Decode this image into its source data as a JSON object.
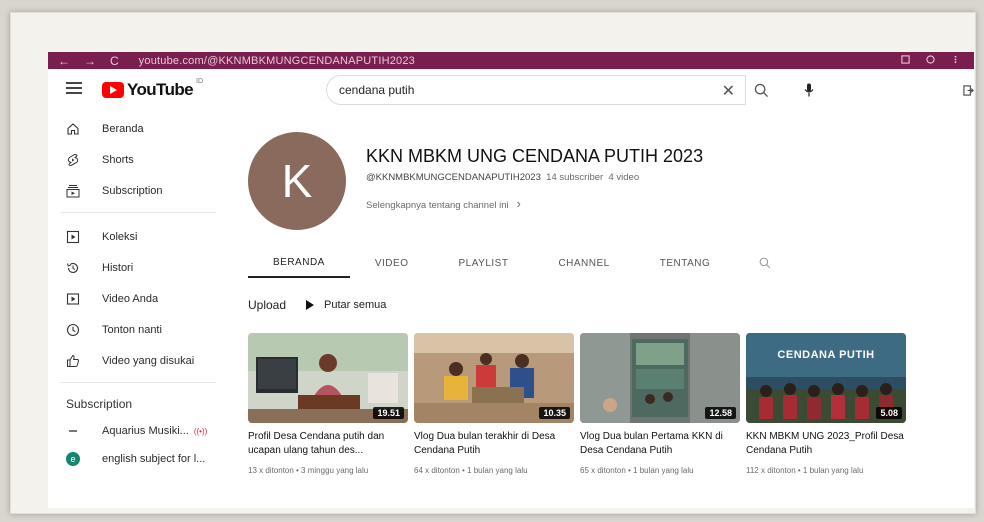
{
  "browser": {
    "back_glyph": "←",
    "forward_glyph": "→",
    "reload_glyph": "C",
    "url": "youtube.com/@KKNMBKMUNGCENDANAPUTIH2023"
  },
  "header": {
    "logo_text": "YouTube",
    "logo_region": "ID",
    "search_value": "cendana putih",
    "clear_glyph": "✕"
  },
  "sidebar": {
    "primary": [
      {
        "label": "Beranda",
        "icon": "home-icon"
      },
      {
        "label": "Shorts",
        "icon": "shorts-icon"
      },
      {
        "label": "Subscription",
        "icon": "subscriptions-icon"
      }
    ],
    "library": [
      {
        "label": "Koleksi",
        "icon": "library-icon"
      },
      {
        "label": "Histori",
        "icon": "history-icon"
      },
      {
        "label": "Video Anda",
        "icon": "your-videos-icon"
      },
      {
        "label": "Tonton nanti",
        "icon": "watch-later-icon"
      },
      {
        "label": "Video yang disukai",
        "icon": "liked-videos-icon"
      }
    ],
    "subscriptions_heading": "Subscription",
    "subscriptions": [
      {
        "label": "Aquarius Musiki...",
        "live": "((•))",
        "color": "#7a7a7a"
      },
      {
        "label": "english subject for l...",
        "avatar_letter": "e",
        "color": "#14866e"
      }
    ]
  },
  "channel": {
    "avatar_letter": "K",
    "avatar_color": "#8a6a5c",
    "name": "KKN MBKM UNG CENDANA PUTIH 2023",
    "handle": "@KKNMBKMUNGCENDANAPUTIH2023",
    "subscribers": "14 subscriber",
    "video_count": "4 video",
    "more_link": "Selengkapnya tentang channel ini",
    "more_chevron": "›"
  },
  "tabs": [
    {
      "label": "BERANDA",
      "active": true
    },
    {
      "label": "VIDEO",
      "active": false
    },
    {
      "label": "PLAYLIST",
      "active": false
    },
    {
      "label": "CHANNEL",
      "active": false
    },
    {
      "label": "TENTANG",
      "active": false
    }
  ],
  "uploads": {
    "label": "Upload",
    "play_all": "Putar semua"
  },
  "videos": [
    {
      "title": "Profil Desa Cendana putih dan ucapan ulang tahun des...",
      "duration": "19.51",
      "meta": "13 x ditonton • 3 minggu yang lalu"
    },
    {
      "title": "Vlog Dua bulan terakhir di Desa Cendana Putih",
      "duration": "10.35",
      "meta": "64 x ditonton • 1 bulan yang lalu"
    },
    {
      "title": "Vlog Dua bulan Pertama KKN di Desa Cendana Putih",
      "duration": "12.58",
      "meta": "65 x ditonton • 1 bulan yang lalu"
    },
    {
      "title": "KKN MBKM UNG 2023_Profil Desa Cendana Putih",
      "duration": "5.08",
      "meta": "112 x ditonton • 1 bulan yang lalu",
      "thumb_text": "CENDANA PUTIH"
    }
  ]
}
